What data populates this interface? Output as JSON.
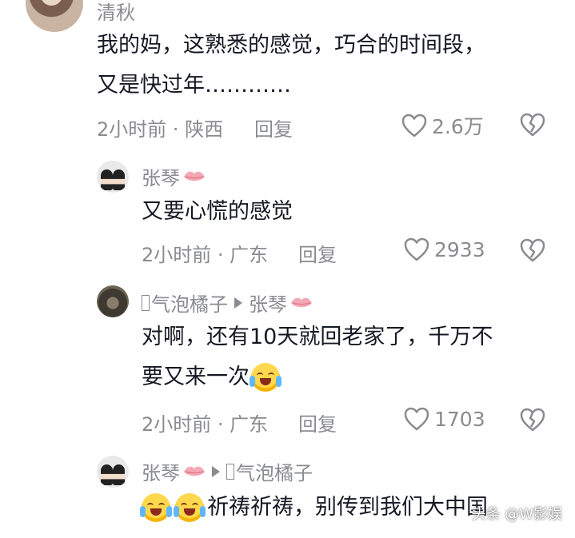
{
  "comments": [
    {
      "username": "清秋",
      "lines": [
        "我的妈，这熟悉的感觉，巧合的时间段，",
        "又是快过年…………"
      ],
      "time_location": "2小时前 · 陕西",
      "reply_label": "回复",
      "likes": "2.6万"
    },
    {
      "username": "张琴",
      "lines": [
        "又要心慌的感觉"
      ],
      "time_location": "2小时前 · 广东",
      "reply_label": "回复",
      "likes": "2933"
    },
    {
      "username": "气泡橘子",
      "reply_to": "张琴",
      "lines": [
        "对啊，还有10天就回老家了，千万不",
        "要又来一次"
      ],
      "time_location": "2小时前 · 广东",
      "reply_label": "回复",
      "likes": "1703"
    },
    {
      "username": "张琴",
      "reply_to": "气泡橘子",
      "lines": [
        "祈祷祈祷，别传到我们大中国"
      ]
    }
  ],
  "watermark": "头条 @W影娱",
  "icons": {
    "like": "heart-outline-icon",
    "dislike": "broken-heart-icon",
    "badge": "lips-kiss-icon",
    "reply_arrow": "play-triangle-icon",
    "emoji_cry": "crying-laughing-emoji-icon"
  },
  "colors": {
    "text": "#161823",
    "meta": "#8a8b91",
    "lips": "#f4a8b6"
  }
}
